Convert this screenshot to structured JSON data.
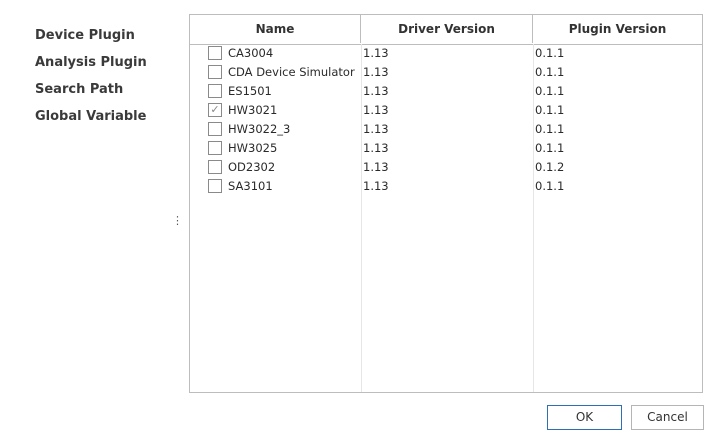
{
  "nav": {
    "items": [
      {
        "label": "Device Plugin"
      },
      {
        "label": "Analysis Plugin"
      },
      {
        "label": "Search Path"
      },
      {
        "label": "Global Variable"
      }
    ]
  },
  "splitter": {
    "glyph": "⋮"
  },
  "grid": {
    "columns": [
      "Name",
      "Driver Version",
      "Plugin Version"
    ],
    "rows": [
      {
        "name": "CA3004",
        "driver": "1.13",
        "plugin": "0.1.1",
        "checked": false
      },
      {
        "name": "CDA Device Simulator",
        "driver": "1.13",
        "plugin": "0.1.1",
        "checked": false
      },
      {
        "name": "ES1501",
        "driver": "1.13",
        "plugin": "0.1.1",
        "checked": false
      },
      {
        "name": "HW3021",
        "driver": "1.13",
        "plugin": "0.1.1",
        "checked": true
      },
      {
        "name": "HW3022_3",
        "driver": "1.13",
        "plugin": "0.1.1",
        "checked": false
      },
      {
        "name": "HW3025",
        "driver": "1.13",
        "plugin": "0.1.1",
        "checked": false
      },
      {
        "name": "OD2302",
        "driver": "1.13",
        "plugin": "0.1.2",
        "checked": false
      },
      {
        "name": "SA3101",
        "driver": "1.13",
        "plugin": "0.1.1",
        "checked": false
      }
    ]
  },
  "buttons": {
    "ok": "OK",
    "cancel": "Cancel"
  },
  "colors": {
    "ok_border": "#2f6fb5",
    "grid_border": "#bdbdbd"
  }
}
